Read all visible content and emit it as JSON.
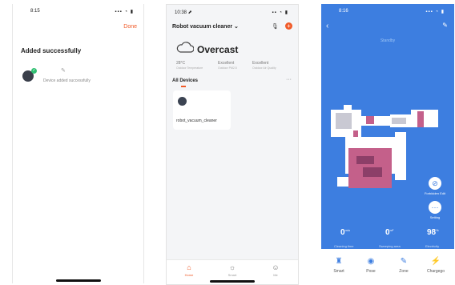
{
  "screen1": {
    "status_time": "8:15",
    "status_icons": "▪▪▪ ◔ ▮",
    "done_label": "Done",
    "title": "Added successfully",
    "device_desc": "Device added successfully"
  },
  "screen2": {
    "status_time": "10:38 ⬈",
    "status_icons": "▪▪ ◔ ▮",
    "home_title": "Robot vacuum cleaner ⌄",
    "weather": "Overcast",
    "stats": [
      {
        "value": "28°C",
        "label": "Outdoor Temperature"
      },
      {
        "value": "Excellent",
        "label": "Outdoor PM2.5"
      },
      {
        "value": "Excellent",
        "label": "Outdoor Air Quality"
      }
    ],
    "all_devices": "All Devices",
    "more": "···",
    "device_name": "robot_vacuum_cleaner",
    "tabs": [
      {
        "icon": "⌂",
        "label": "Home"
      },
      {
        "icon": "☼",
        "label": "Smart"
      },
      {
        "icon": "☺",
        "label": "Me"
      }
    ],
    "accent": "#f05a28"
  },
  "screen3": {
    "status_time": "8:16",
    "status_icons": "▪▪▪ ◔ ▮",
    "state": "Standby",
    "side_buttons": [
      {
        "icon": "⊘",
        "label": "Forbidden Edit"
      },
      {
        "icon": "···",
        "label": "Setting"
      }
    ],
    "stats": [
      {
        "value": "0",
        "unit": "min",
        "label": "Cleaning time"
      },
      {
        "value": "0",
        "unit": "m²",
        "label": "Sweeping area"
      },
      {
        "value": "98",
        "unit": "%",
        "label": "Electricity"
      }
    ],
    "bottom_tabs": [
      {
        "icon": "♜",
        "label": "Smart"
      },
      {
        "icon": "◉",
        "label": "Pose"
      },
      {
        "icon": "✎",
        "label": "Zone"
      },
      {
        "icon": "⚡",
        "label": "Chargego"
      }
    ],
    "accent": "#3d7ee0"
  }
}
